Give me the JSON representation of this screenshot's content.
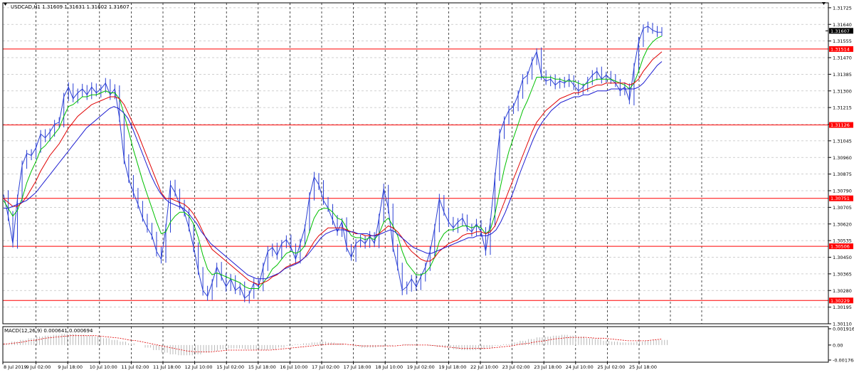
{
  "symbol_line": "USDCAD,H1  1.31609 1.31631 1.31602 1.31607",
  "colors": {
    "price": "#2a3fd4",
    "ma_fast": "#00c000",
    "ma_mid": "#e00000",
    "ma_slow": "#1a1ad0",
    "level": "#ff0000",
    "grid": "#c0c0c0",
    "border": "#000000"
  },
  "chart_data": [
    {
      "type": "line",
      "title": "USDCAD,H1  1.31609 1.31631 1.31602 1.31607",
      "ylim": [
        1.3011,
        1.3175
      ],
      "y_ticks": [
        "1.31725",
        "1.31640",
        "1.31555",
        "1.31470",
        "1.31385",
        "1.31300",
        "1.31215",
        "1.31130",
        "1.31045",
        "1.30960",
        "1.30875",
        "1.30790",
        "1.30705",
        "1.30620",
        "1.30535",
        "1.30450",
        "1.30365",
        "1.30280",
        "1.30195",
        "1.30110"
      ],
      "x_ticks": [
        "8 Jul 2019",
        "9 Jul 02:00",
        "9 Jul 18:00",
        "10 Jul 10:00",
        "11 Jul 02:00",
        "11 Jul 18:00",
        "12 Jul 10:00",
        "15 Jul 02:00",
        "15 Jul 18:00",
        "16 Jul 10:00",
        "17 Jul 02:00",
        "17 Jul 18:00",
        "18 Jul 10:00",
        "19 Jul 02:00",
        "19 Jul 18:00",
        "22 Jul 10:00",
        "23 Jul 02:00",
        "23 Jul 18:00",
        "24 Jul 10:00",
        "25 Jul 02:00",
        "25 Jul 18:00"
      ],
      "current_price": "1.31607",
      "levels": [
        "1.31514",
        "1.31126",
        "1.30751",
        "1.30506",
        "1.30229"
      ],
      "series": [
        {
          "key": "price",
          "values": [
            1.3077,
            1.3066,
            1.3052,
            1.3075,
            1.3092,
            1.3098,
            1.3097,
            1.3101,
            1.3108,
            1.3106,
            1.3109,
            1.3113,
            1.3114,
            1.3127,
            1.3132,
            1.3126,
            1.3129,
            1.3131,
            1.3128,
            1.3132,
            1.3129,
            1.3131,
            1.3134,
            1.3128,
            1.3131,
            1.3116,
            1.3095,
            1.3085,
            1.3078,
            1.3072,
            1.3065,
            1.306,
            1.3056,
            1.3048,
            1.3044,
            1.306,
            1.3082,
            1.3078,
            1.3072,
            1.3068,
            1.306,
            1.305,
            1.3038,
            1.3028,
            1.3025,
            1.3032,
            1.304,
            1.3035,
            1.303,
            1.3034,
            1.3028,
            1.303,
            1.3024,
            1.3026,
            1.3032,
            1.303,
            1.304,
            1.3048,
            1.305,
            1.3046,
            1.3052,
            1.3054,
            1.305,
            1.3044,
            1.3052,
            1.306,
            1.3076,
            1.3086,
            1.3082,
            1.3074,
            1.307,
            1.3064,
            1.3058,
            1.3063,
            1.305,
            1.3045,
            1.3052,
            1.3054,
            1.3052,
            1.3056,
            1.3052,
            1.3065,
            1.308,
            1.307,
            1.305,
            1.304,
            1.3028,
            1.303,
            1.3034,
            1.303,
            1.3035,
            1.304,
            1.3048,
            1.306,
            1.3075,
            1.3068,
            1.3063,
            1.306,
            1.3063,
            1.3065,
            1.306,
            1.3058,
            1.3062,
            1.3058,
            1.3048,
            1.3063,
            1.3086,
            1.3108,
            1.3115,
            1.312,
            1.3122,
            1.3128,
            1.3136,
            1.3138,
            1.3145,
            1.315,
            1.3138,
            1.3135,
            1.3136,
            1.3133,
            1.3135,
            1.3134,
            1.3136,
            1.3133,
            1.313,
            1.3132,
            1.3135,
            1.3138,
            1.314,
            1.3136,
            1.3138,
            1.3136,
            1.3134,
            1.313,
            1.3132,
            1.3125,
            1.3142,
            1.3155,
            1.3162,
            1.3163,
            1.3161,
            1.316,
            1.316
          ]
        },
        {
          "key": "ma_fast",
          "values": [
            1.3074,
            1.307,
            1.3066,
            1.3069,
            1.3075,
            1.3083,
            1.3089,
            1.3094,
            1.31,
            1.3102,
            1.3105,
            1.3108,
            1.3111,
            1.3117,
            1.3122,
            1.3123,
            1.3125,
            1.3127,
            1.3127,
            1.3128,
            1.3128,
            1.3129,
            1.313,
            1.3129,
            1.3129,
            1.3126,
            1.3118,
            1.3109,
            1.31,
            1.3092,
            1.3084,
            1.3077,
            1.307,
            1.3063,
            1.3057,
            1.3058,
            1.3063,
            1.3066,
            1.3068,
            1.3068,
            1.3066,
            1.3062,
            1.3055,
            1.3046,
            1.3039,
            1.3036,
            1.3037,
            1.3036,
            1.3035,
            1.3034,
            1.3033,
            1.3032,
            1.303,
            1.3029,
            1.3029,
            1.3029,
            1.3032,
            1.3035,
            1.3039,
            1.3041,
            1.3044,
            1.3047,
            1.3048,
            1.3047,
            1.3048,
            1.3051,
            1.3058,
            1.3065,
            1.3069,
            1.307,
            1.307,
            1.3068,
            1.3065,
            1.3064,
            1.306,
            1.3056,
            1.3055,
            1.3055,
            1.3054,
            1.3055,
            1.3054,
            1.3057,
            1.3063,
            1.3065,
            1.3061,
            1.3056,
            1.3048,
            1.3042,
            1.3039,
            1.3036,
            1.3036,
            1.3037,
            1.304,
            1.3045,
            1.3053,
            1.3057,
            1.3059,
            1.3059,
            1.306,
            1.3061,
            1.3061,
            1.306,
            1.3061,
            1.306,
            1.3057,
            1.3059,
            1.3067,
            1.3079,
            1.309,
            1.3099,
            1.3106,
            1.3113,
            1.312,
            1.3125,
            1.3131,
            1.3137,
            1.3137,
            1.3137,
            1.3137,
            1.3136,
            1.3136,
            1.3135,
            1.3135,
            1.3135,
            1.3134,
            1.3133,
            1.3134,
            1.3135,
            1.3136,
            1.3136,
            1.3136,
            1.3136,
            1.3135,
            1.3134,
            1.3133,
            1.3131,
            1.3134,
            1.314,
            1.3147,
            1.3152,
            1.3155,
            1.3157,
            1.3158
          ]
        },
        {
          "key": "ma_mid",
          "values": [
            1.3075,
            1.3073,
            1.3071,
            1.3071,
            1.3073,
            1.3076,
            1.308,
            1.3084,
            1.3089,
            1.3093,
            1.3097,
            1.31,
            1.3103,
            1.3107,
            1.3111,
            1.3114,
            1.3117,
            1.3119,
            1.3121,
            1.3123,
            1.3124,
            1.3125,
            1.3126,
            1.3127,
            1.3127,
            1.3126,
            1.3123,
            1.3118,
            1.3113,
            1.3108,
            1.3102,
            1.3096,
            1.309,
            1.3084,
            1.3078,
            1.3075,
            1.3075,
            1.3074,
            1.3073,
            1.3072,
            1.307,
            1.3067,
            1.3063,
            1.3058,
            1.3053,
            1.3049,
            1.3047,
            1.3045,
            1.3043,
            1.3041,
            1.3039,
            1.3037,
            1.3035,
            1.3033,
            1.3032,
            1.3031,
            1.3032,
            1.3033,
            1.3035,
            1.3036,
            1.3038,
            1.304,
            1.3041,
            1.3042,
            1.3043,
            1.3045,
            1.3049,
            1.3053,
            1.3056,
            1.3058,
            1.306,
            1.306,
            1.306,
            1.306,
            1.3059,
            1.3058,
            1.3057,
            1.3057,
            1.3056,
            1.3056,
            1.3056,
            1.3057,
            1.3059,
            1.3061,
            1.306,
            1.3058,
            1.3055,
            1.3051,
            1.3048,
            1.3046,
            1.3044,
            1.3043,
            1.3043,
            1.3045,
            1.3048,
            1.305,
            1.3052,
            1.3053,
            1.3054,
            1.3056,
            1.3057,
            1.3057,
            1.3058,
            1.3058,
            1.3057,
            1.3058,
            1.3061,
            1.3067,
            1.3073,
            1.3079,
            1.3085,
            1.3091,
            1.3097,
            1.3103,
            1.3109,
            1.3114,
            1.3117,
            1.312,
            1.3122,
            1.3124,
            1.3126,
            1.3127,
            1.3128,
            1.3129,
            1.3129,
            1.313,
            1.3131,
            1.3132,
            1.3133,
            1.3133,
            1.3134,
            1.3134,
            1.3134,
            1.3134,
            1.3134,
            1.3133,
            1.3134,
            1.3136,
            1.314,
            1.3143,
            1.3146,
            1.3148,
            1.315
          ]
        },
        {
          "key": "ma_slow",
          "values": [
            1.307,
            1.307,
            1.3071,
            1.3072,
            1.3073,
            1.3074,
            1.3076,
            1.3078,
            1.3081,
            1.3084,
            1.3087,
            1.309,
            1.3093,
            1.3096,
            1.3099,
            1.3102,
            1.3105,
            1.3108,
            1.3111,
            1.3113,
            1.3115,
            1.3117,
            1.3119,
            1.3121,
            1.3122,
            1.3121,
            1.3119,
            1.3116,
            1.3111,
            1.3105,
            1.3099,
            1.3093,
            1.3087,
            1.3082,
            1.3078,
            1.3075,
            1.3073,
            1.3072,
            1.3071,
            1.307,
            1.3068,
            1.3065,
            1.3062,
            1.3058,
            1.3055,
            1.3052,
            1.305,
            1.3048,
            1.3046,
            1.3044,
            1.3042,
            1.304,
            1.3038,
            1.3036,
            1.3035,
            1.3034,
            1.3034,
            1.3034,
            1.3035,
            1.3036,
            1.3037,
            1.3039,
            1.304,
            1.3041,
            1.3042,
            1.3044,
            1.3046,
            1.3049,
            1.3052,
            1.3055,
            1.3057,
            1.3058,
            1.3059,
            1.3059,
            1.3059,
            1.3058,
            1.3058,
            1.3057,
            1.3057,
            1.3057,
            1.3056,
            1.3056,
            1.3057,
            1.3058,
            1.3059,
            1.3058,
            1.3056,
            1.3054,
            1.3052,
            1.305,
            1.3049,
            1.3048,
            1.3047,
            1.3047,
            1.3048,
            1.3049,
            1.305,
            1.3051,
            1.3052,
            1.3053,
            1.3054,
            1.3055,
            1.3055,
            1.3056,
            1.3056,
            1.3056,
            1.3057,
            1.3059,
            1.3063,
            1.3068,
            1.3074,
            1.308,
            1.3087,
            1.3093,
            1.3099,
            1.3105,
            1.311,
            1.3114,
            1.3117,
            1.312,
            1.3122,
            1.3124,
            1.3125,
            1.3126,
            1.3127,
            1.3127,
            1.3128,
            1.3128,
            1.3129,
            1.313,
            1.313,
            1.313,
            1.3131,
            1.3131,
            1.3131,
            1.3131,
            1.3131,
            1.3131,
            1.3132,
            1.3134,
            1.3137,
            1.314,
            1.3143,
            1.3145
          ]
        }
      ]
    },
    {
      "type": "bar",
      "title": "MACD(12,26,9) 0.000641 0.000694",
      "ylim": [
        -0.001768,
        0.001916
      ],
      "y_ticks": [
        "0.001916",
        "0.00",
        "-0.001768"
      ],
      "series": [
        {
          "key": "macd",
          "values": [
            0.0002,
            0.0004,
            0.0006,
            0.0008,
            0.001,
            0.0011,
            0.0012,
            0.0013,
            0.0013,
            0.0012,
            0.0011,
            0.001,
            0.0008,
            0.0006,
            0.0004,
            0.0002,
            0.0,
            -0.0003,
            -0.0006,
            -0.0009,
            -0.0011,
            -0.0012,
            -0.0012,
            -0.0011,
            -0.0009,
            -0.0007,
            -0.0005,
            -0.0004,
            -0.0004,
            -0.0005,
            -0.0006,
            -0.0006,
            -0.0005,
            -0.0003,
            -0.0001,
            0.0001,
            0.0002,
            0.0003,
            0.0004,
            0.0003,
            0.0002,
            0.0,
            -0.0002,
            -0.0003,
            -0.0003,
            -0.0002,
            -0.0001,
            0.0,
            0.0001,
            0.0001,
            0.0,
            -0.0001,
            -0.0002,
            -0.0003,
            -0.0005,
            -0.0006,
            -0.0006,
            -0.0005,
            -0.0003,
            -0.0001,
            0.0001,
            0.0003,
            0.0005,
            0.0007,
            0.0009,
            0.001,
            0.0011,
            0.0012,
            0.0011,
            0.001,
            0.0008,
            0.0007,
            0.0005,
            0.0004,
            0.0003,
            0.0003,
            0.0004,
            0.0005,
            0.0006,
            0.0006
          ]
        },
        {
          "key": "signal",
          "values": [
            0.0001,
            0.0002,
            0.0003,
            0.0005,
            0.0006,
            0.0008,
            0.0009,
            0.001,
            0.0011,
            0.0011,
            0.0011,
            0.0011,
            0.001,
            0.0009,
            0.0008,
            0.0006,
            0.0005,
            0.0003,
            0.0001,
            -0.0001,
            -0.0003,
            -0.0005,
            -0.0007,
            -0.0008,
            -0.0008,
            -0.0008,
            -0.0007,
            -0.0006,
            -0.0006,
            -0.0006,
            -0.0006,
            -0.0006,
            -0.0006,
            -0.0005,
            -0.0004,
            -0.0003,
            -0.0002,
            -0.0001,
            0.0,
            0.0001,
            0.0001,
            0.0001,
            0.0,
            -0.0001,
            -0.0001,
            -0.0001,
            -0.0001,
            -0.0001,
            0.0,
            0.0,
            0.0,
            0.0,
            -0.0001,
            -0.0002,
            -0.0003,
            -0.0004,
            -0.0004,
            -0.0004,
            -0.0004,
            -0.0003,
            -0.0002,
            -0.0001,
            0.0001,
            0.0002,
            0.0004,
            0.0005,
            0.0007,
            0.0008,
            0.0009,
            0.0009,
            0.0009,
            0.0008,
            0.0008,
            0.0007,
            0.0006,
            0.0005,
            0.0005,
            0.0005,
            0.0006,
            0.0007
          ]
        }
      ]
    }
  ]
}
